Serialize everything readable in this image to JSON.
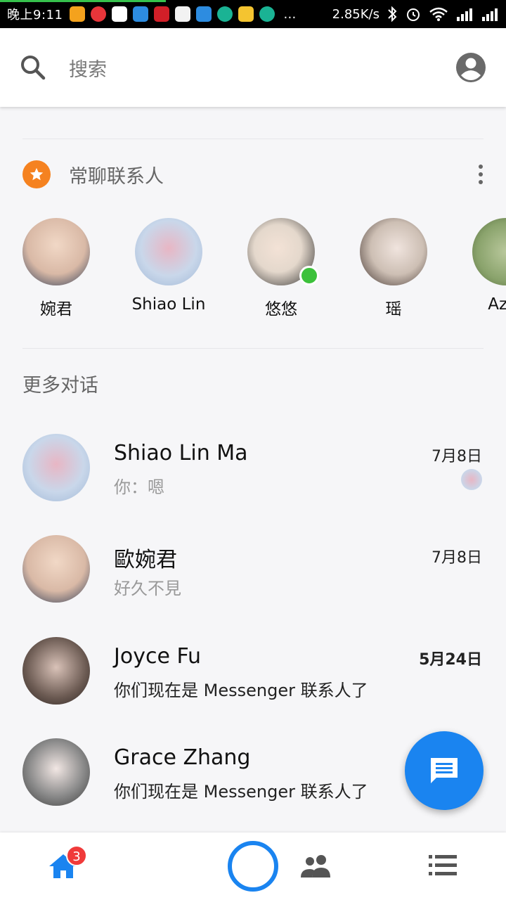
{
  "status_bar": {
    "time": "晚上9:11",
    "speed": "2.85K/s"
  },
  "search": {
    "placeholder": "搜索"
  },
  "favorites": {
    "title": "常聊联系人",
    "items": [
      {
        "name": "婉君",
        "color": "#d9b9a6"
      },
      {
        "name": "Shiao Lin",
        "color": "#c9d7ea"
      },
      {
        "name": "悠悠",
        "color": "#e4d8cc"
      },
      {
        "name": "瑶",
        "color": "#cdbfb4"
      },
      {
        "name": "Azer",
        "color": "#8aa36c"
      }
    ]
  },
  "more_conversations": {
    "title": "更多对话",
    "items": [
      {
        "name": "Shiao Lin Ma",
        "snippet": "你：嗯",
        "date": "7月8日",
        "color": "#c9d7ea"
      },
      {
        "name": "歐婉君",
        "snippet": "好久不見",
        "date": "7月8日",
        "color": "#d9b9a6"
      },
      {
        "name": "Joyce Fu",
        "snippet": "你们现在是 Messenger 联系人了",
        "date": "5月24日",
        "color": "#6b5a52"
      },
      {
        "name": "Grace Zhang",
        "snippet": "你们现在是 Messenger 联系人了",
        "date": "",
        "color": "#4a4a4a"
      }
    ]
  },
  "bottom_nav": {
    "badge": "3"
  },
  "colors": {
    "accent": "#1a84f0",
    "star": "#f58220",
    "online": "#3cc13b"
  }
}
